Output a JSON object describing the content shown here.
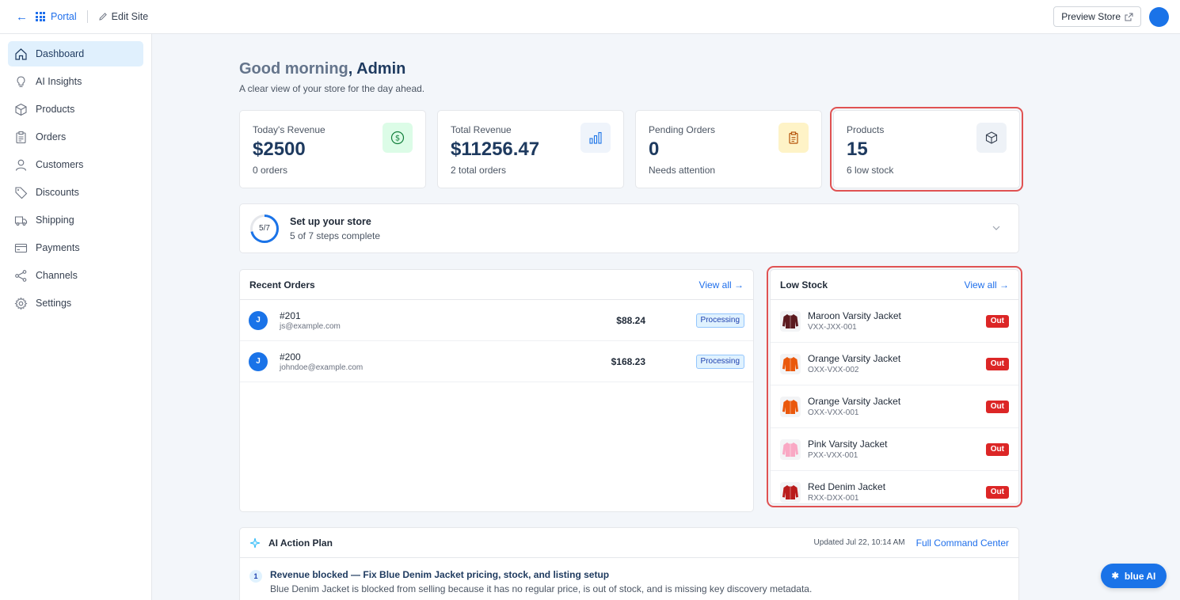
{
  "topbar": {
    "portal_label": "Portal",
    "edit_site_label": "Edit Site",
    "preview_label": "Preview Store"
  },
  "sidebar": {
    "items": [
      {
        "label": "Dashboard",
        "icon": "home-icon",
        "active": true
      },
      {
        "label": "AI Insights",
        "icon": "lightbulb-icon"
      },
      {
        "label": "Products",
        "icon": "box-icon"
      },
      {
        "label": "Orders",
        "icon": "clipboard-icon"
      },
      {
        "label": "Customers",
        "icon": "user-icon"
      },
      {
        "label": "Discounts",
        "icon": "tag-icon"
      },
      {
        "label": "Shipping",
        "icon": "truck-icon"
      },
      {
        "label": "Payments",
        "icon": "credit-card-icon"
      },
      {
        "label": "Channels",
        "icon": "share-icon"
      },
      {
        "label": "Settings",
        "icon": "gear-icon"
      }
    ]
  },
  "greeting": {
    "prefix": "Good morning",
    "name": ", Admin",
    "subtitle": "A clear view of your store for the day ahead."
  },
  "stats": [
    {
      "label": "Today's Revenue",
      "value": "$2500",
      "note": "0 orders",
      "icon": "dollar-icon"
    },
    {
      "label": "Total Revenue",
      "value": "$11256.47",
      "note": "2 total orders",
      "icon": "bar-chart-icon"
    },
    {
      "label": "Pending Orders",
      "value": "0",
      "note": "Needs attention",
      "icon": "clipboard-icon"
    },
    {
      "label": "Products",
      "value": "15",
      "note": "6 low stock",
      "icon": "box-icon"
    }
  ],
  "setup": {
    "progress_label": "5/7",
    "progress_fraction": 0.714,
    "title": "Set up your store",
    "subtitle": "5 of 7 steps complete"
  },
  "recent_orders": {
    "title": "Recent Orders",
    "view_all": "View all →",
    "rows": [
      {
        "avatar": "J",
        "id": "#201",
        "email": "js@example.com",
        "amount": "$88.24",
        "status": "Processing"
      },
      {
        "avatar": "J",
        "id": "#200",
        "email": "johndoe@example.com",
        "amount": "$168.23",
        "status": "Processing"
      }
    ]
  },
  "low_stock": {
    "title": "Low Stock",
    "view_all": "View all →",
    "rows": [
      {
        "name": "Maroon Varsity Jacket",
        "sku": "VXX-JXX-001",
        "badge": "Out",
        "color": "#5b1a1f"
      },
      {
        "name": "Orange Varsity Jacket",
        "sku": "OXX-VXX-002",
        "badge": "Out",
        "color": "#ea580c"
      },
      {
        "name": "Orange Varsity Jacket",
        "sku": "OXX-VXX-001",
        "badge": "Out",
        "color": "#ea580c"
      },
      {
        "name": "Pink Varsity Jacket",
        "sku": "PXX-VXX-001",
        "badge": "Out",
        "color": "#f9a8c4"
      },
      {
        "name": "Red Denim Jacket",
        "sku": "RXX-DXX-001",
        "badge": "Out",
        "color": "#b91c1c"
      }
    ]
  },
  "ai_plan": {
    "title": "AI Action Plan",
    "updated": "Updated Jul 22, 10:14 AM",
    "link": "Full Command Center",
    "items": [
      {
        "num": "1",
        "title": "Revenue blocked — Fix Blue Denim Jacket pricing, stock, and listing setup",
        "desc": "Blue Denim Jacket is blocked from selling because it has no regular price, is out of stock, and is missing key discovery metadata."
      }
    ]
  },
  "assistant": {
    "label": "blue AI"
  },
  "colors": {
    "accent": "#1a73e8",
    "highlight": "#e05252",
    "danger": "#dc2626"
  }
}
